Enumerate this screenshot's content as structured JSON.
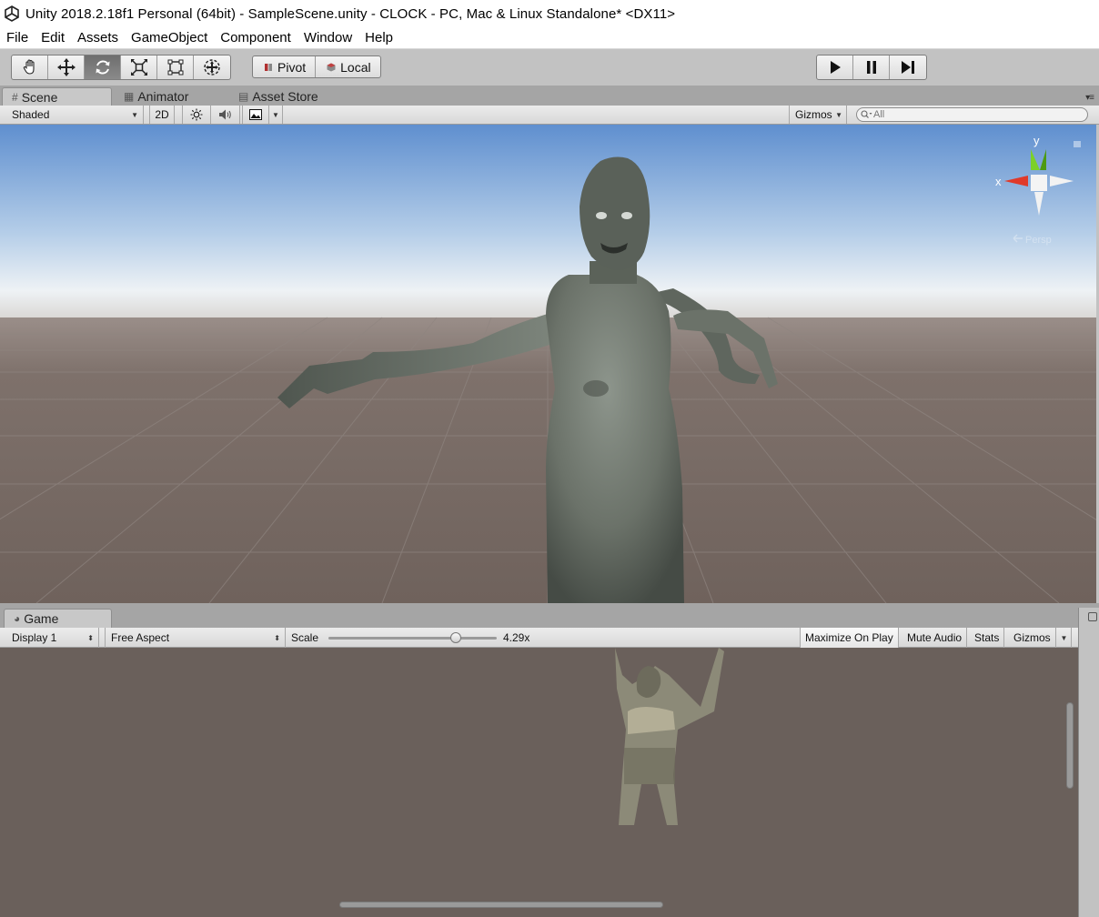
{
  "window": {
    "title": "Unity 2018.2.18f1 Personal (64bit) - SampleScene.unity - CLOCK - PC, Mac & Linux Standalone* <DX11>"
  },
  "menu": [
    "File",
    "Edit",
    "Assets",
    "GameObject",
    "Component",
    "Window",
    "Help"
  ],
  "toolbar": {
    "transform_tools": [
      "hand-tool",
      "move-tool",
      "rotate-tool",
      "scale-tool",
      "rect-tool",
      "transform-tool"
    ],
    "active_tool": "rotate-tool",
    "pivot_label": "Pivot",
    "local_label": "Local",
    "play_controls": [
      "play",
      "pause",
      "step"
    ]
  },
  "scene_tabs": [
    {
      "label": "Scene",
      "icon": "grid-icon",
      "active": true
    },
    {
      "label": "Animator",
      "icon": "animator-icon",
      "active": false
    },
    {
      "label": "Asset Store",
      "icon": "store-icon",
      "active": false
    }
  ],
  "scene_bar": {
    "shading_mode": "Shaded",
    "mode_2d": "2D",
    "gizmos_label": "Gizmos",
    "search_placeholder": "All"
  },
  "gizmo": {
    "y_label": "y",
    "x_label": "x",
    "projection_label": "Persp",
    "colors": {
      "x": "#e03a2a",
      "y": "#7cd02a",
      "neutral": "#ffffff"
    }
  },
  "game_tabs": [
    {
      "label": "Game",
      "icon": "game-icon",
      "active": true
    }
  ],
  "game_bar": {
    "display": "Display 1",
    "aspect": "Free Aspect",
    "scale_label": "Scale",
    "scale_value": "4.29x",
    "scale_fraction": 0.755,
    "maximize_label": "Maximize On Play",
    "mute_label": "Mute Audio",
    "stats_label": "Stats",
    "gizmos_label": "Gizmos"
  }
}
